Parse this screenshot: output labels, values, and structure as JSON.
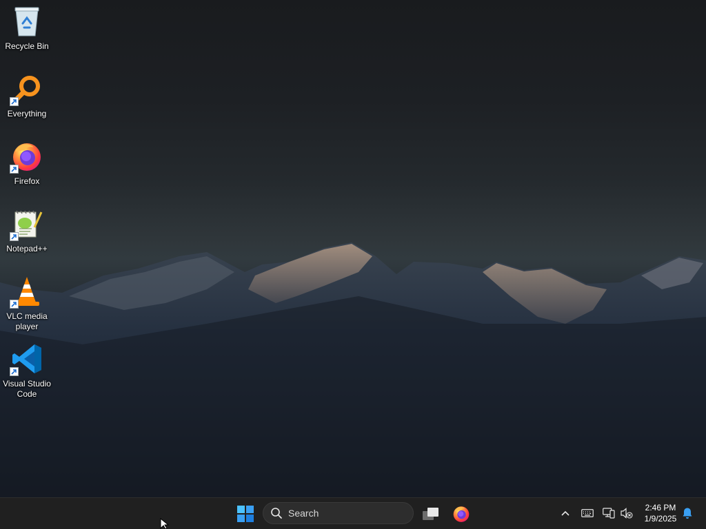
{
  "desktop": {
    "icons": [
      {
        "label": "Recycle Bin",
        "icon": "recycle-bin-icon"
      },
      {
        "label": "Everything",
        "icon": "everything-search-icon"
      },
      {
        "label": "Firefox",
        "icon": "firefox-icon"
      },
      {
        "label": "Notepad++",
        "icon": "notepad-plus-plus-icon"
      },
      {
        "label": "VLC media player",
        "icon": "vlc-cone-icon"
      },
      {
        "label": "Visual Studio Code",
        "icon": "vscode-icon"
      }
    ]
  },
  "taskbar": {
    "start_icon": "windows-start-icon",
    "search_placeholder": "Search",
    "pinned": [
      {
        "name": "Task View",
        "icon": "task-view-icon"
      },
      {
        "name": "Firefox",
        "icon": "firefox-icon"
      }
    ],
    "tray": {
      "icons": [
        "chevron-up-icon",
        "keyboard-icon",
        "network-icon",
        "volume-muted-icon",
        "notification-bell-icon"
      ],
      "time": "2:46 PM",
      "date": "1/9/2025"
    }
  },
  "colors": {
    "taskbar_bg": "#202020",
    "accent_blue": "#3aa0f3",
    "notification_bell": "#3aa0f3"
  }
}
